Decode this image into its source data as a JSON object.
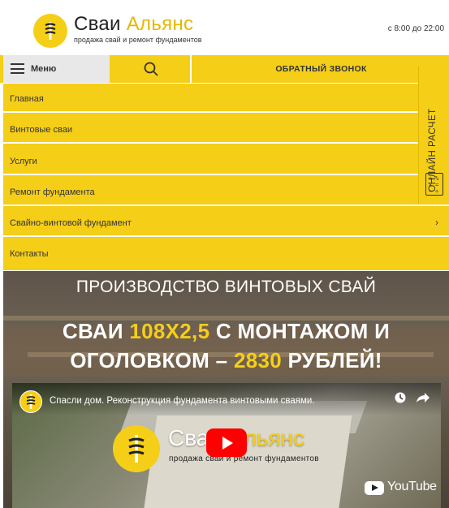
{
  "header": {
    "brand_part1": "Сваи",
    "brand_part2": "Альянс",
    "tagline": "продажа свай и ремонт фундаментов",
    "hours": "с 8:00 до 22:00",
    "logo_icon": "pile-screw-icon"
  },
  "topbar": {
    "menu_label": "Меню",
    "search_icon": "search-icon",
    "callback_label": "ОБРАТНЫЙ ЗВОНОК"
  },
  "nav": {
    "items": [
      {
        "label": "Главная"
      },
      {
        "label": "Винтовые сваи"
      },
      {
        "label": "Услуги"
      },
      {
        "label": "Ремонт фундамента"
      },
      {
        "label": "Свайно-винтовой фундамент",
        "chevron": "›"
      },
      {
        "label": "Контакты"
      }
    ]
  },
  "side_tab": {
    "label": "ОНЛАЙН РАСЧЕТ",
    "icon": "calculator-icon"
  },
  "hero": {
    "subtitle": "ПРОИЗВОДСТВО ВИНТОВЫХ СВАЙ",
    "title_part1": "СВАИ ",
    "title_highlight1": "108Х2,5",
    "title_part2": " С МОНТАЖОМ И",
    "title_part3": "ОГОЛОВКОМ – ",
    "title_highlight2": "2830",
    "title_part4": " РУБЛЕЙ!"
  },
  "video": {
    "title": "Спасли дом. Реконструкция фундамента винтовыми сваями.",
    "brand_part1": "Сваи",
    "brand_part2": "Альянс",
    "tagline": "продажа свай и ремонт фундаментов",
    "youtube_label": "YouTube"
  },
  "colors": {
    "accent": "#f5ce18",
    "menu_bg": "#e8e8e8",
    "play_red": "#ff0000"
  }
}
